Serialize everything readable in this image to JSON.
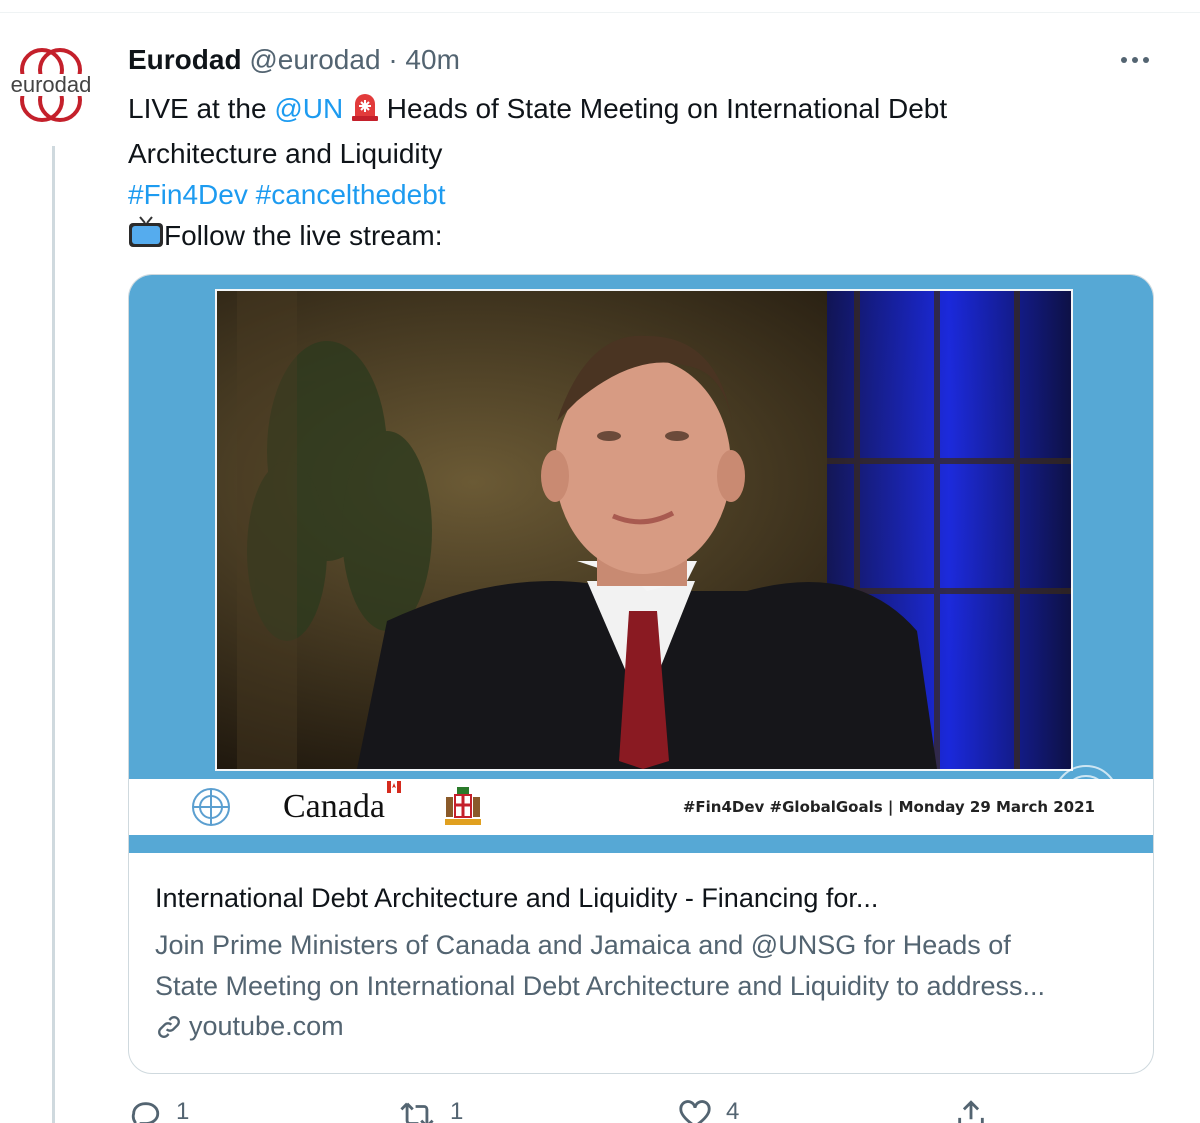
{
  "tweet": {
    "author": {
      "name": "Eurodad",
      "handle": "@eurodad",
      "avatar_text": "eurodad",
      "separator": "·",
      "time": "40m"
    },
    "text": {
      "line1_prefix": "LIVE at the ",
      "mention": "@UN",
      "line1_suffix": " Heads of State Meeting on International Debt",
      "line2": "Architecture and Liquidity",
      "hashtag1": "#Fin4Dev",
      "hashtag2": "#cancelthedebt",
      "line4": "Follow the live stream:"
    },
    "card": {
      "banner_brand": "Canada",
      "banner_tags": "#Fin4Dev  #GlobalGoals  |  Monday 29 March 2021",
      "title": "International Debt Architecture and Liquidity - Financing for...",
      "description_line1": "Join Prime Ministers of Canada and Jamaica and @UNSG for Heads of",
      "description_line2": "State Meeting on International Debt Architecture and Liquidity to address...",
      "domain": "youtube.com"
    },
    "actions": {
      "replies": "1",
      "retweets": "1",
      "likes": "4"
    },
    "icons": [
      "more-icon",
      "siren-emoji-icon",
      "tv-emoji-icon",
      "link-icon",
      "reply-icon",
      "retweet-icon",
      "like-icon",
      "share-icon"
    ],
    "colors": {
      "link": "#1d9bf0",
      "secondary": "#536471",
      "brand_red": "#c4202b",
      "media_bg": "#56a8d5"
    }
  }
}
